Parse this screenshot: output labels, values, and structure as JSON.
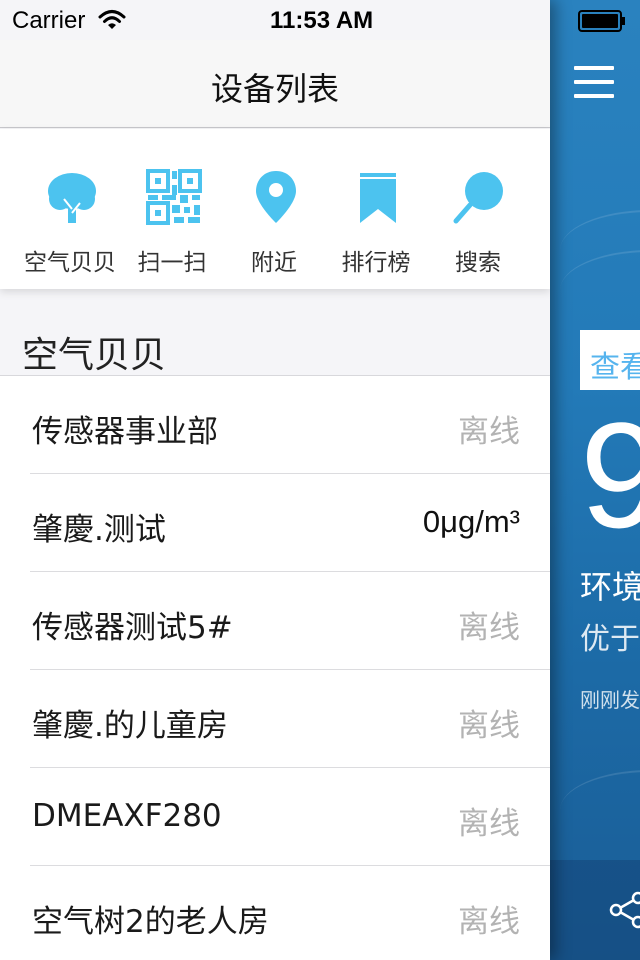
{
  "status_bar": {
    "carrier": "Carrier",
    "time": "11:53 AM"
  },
  "nav": {
    "title": "设备列表"
  },
  "quick_actions": [
    {
      "label": "空气贝贝",
      "icon": "tree-icon"
    },
    {
      "label": "扫一扫",
      "icon": "qrcode-icon"
    },
    {
      "label": "附近",
      "icon": "location-pin-icon"
    },
    {
      "label": "排行榜",
      "icon": "bookmark-icon"
    },
    {
      "label": "搜索",
      "icon": "search-icon"
    }
  ],
  "section": {
    "title": "空气贝贝"
  },
  "devices": [
    {
      "name": "传感器事业部",
      "status": "离线"
    },
    {
      "name": "肇慶.测试",
      "status": "0μg/m³"
    },
    {
      "name": "传感器测试5#",
      "status": "离线"
    },
    {
      "name": "肇慶.的儿童房",
      "status": "离线"
    },
    {
      "name": "DMEAXF280",
      "status": "离线"
    },
    {
      "name": "空气树2的老人房",
      "status": "离线"
    }
  ],
  "right_panel": {
    "view_label": "查看",
    "big_number": "9",
    "env_text": "环境",
    "better_text": "优于",
    "update_text": "刚刚发"
  },
  "colors": {
    "accent": "#4cc3ef",
    "panel_blue": "#237ab8"
  }
}
